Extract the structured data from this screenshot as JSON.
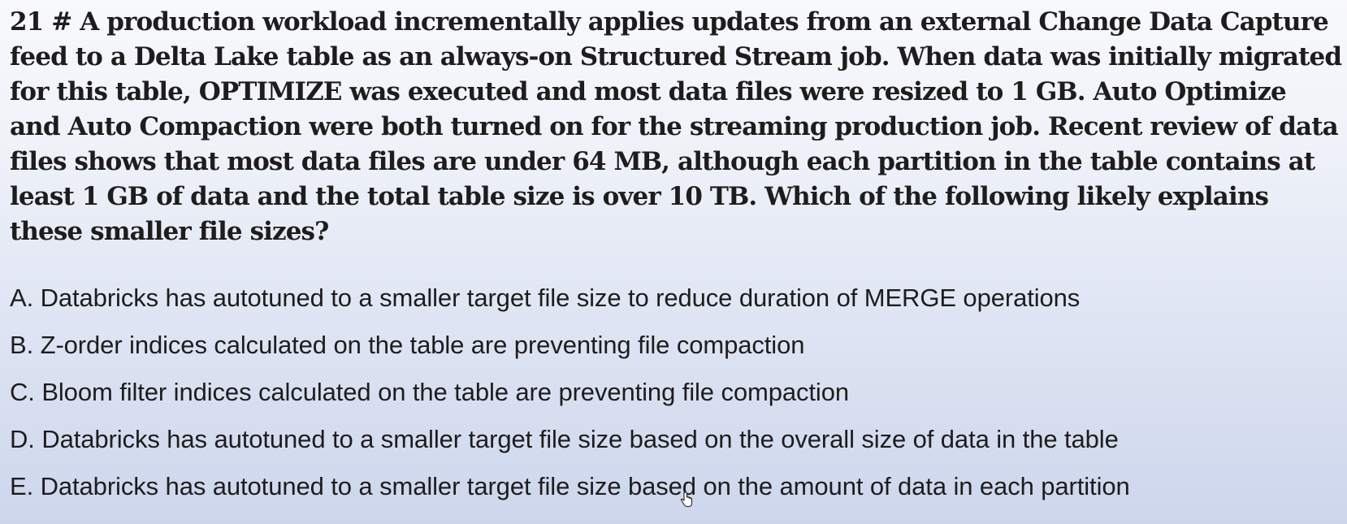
{
  "question": {
    "text": "21 # A production workload incrementally applies updates from an external Change Data Capture feed to a Delta Lake table as an always-on Structured Stream job. When data was initially migrated for this table, OPTIMIZE was executed and most data files were resized to 1 GB. Auto Optimize and Auto Compaction were both turned on for the streaming production job. Recent review of data files shows that most data files are under 64 MB, although each partition in the table contains at least 1 GB of data and the total table size is over 10 TB. Which of the following likely explains these smaller file sizes?"
  },
  "options": [
    {
      "text": "A. Databricks has autotuned to a smaller target file size to reduce duration of MERGE operations"
    },
    {
      "text": "B. Z-order indices calculated on the table are preventing file compaction"
    },
    {
      "text": "C. Bloom filter indices calculated on the table are preventing file compaction"
    },
    {
      "text": "D. Databricks has autotuned to a smaller target file size based on the overall size of data in the table"
    },
    {
      "text": "E. Databricks has autotuned to a smaller target file size based on the amount of data in each partition"
    }
  ],
  "cursor": {
    "icon": "hand-pointer-icon"
  }
}
